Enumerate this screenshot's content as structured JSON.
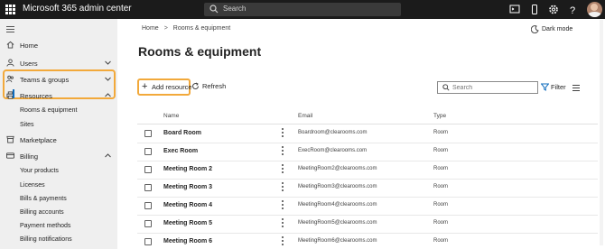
{
  "header": {
    "app_title": "Microsoft 365 admin center",
    "search_placeholder": "Search",
    "icons": [
      "waffle-icon",
      "search-icon",
      "terminal-icon",
      "mobile-icon",
      "settings-icon",
      "help-icon",
      "avatar"
    ]
  },
  "sidebar": {
    "items": [
      {
        "label": "Home",
        "icon": "home-icon"
      },
      {
        "label": "Users",
        "icon": "user-icon",
        "chevron": "down"
      },
      {
        "label": "Teams & groups",
        "icon": "people-icon",
        "chevron": "down"
      },
      {
        "label": "Resources",
        "icon": "printer-icon",
        "chevron": "up"
      },
      {
        "label": "Rooms & equipment",
        "sub": true,
        "selected": true
      },
      {
        "label": "Sites",
        "sub": true
      },
      {
        "label": "Marketplace",
        "icon": "store-icon"
      },
      {
        "label": "Billing",
        "icon": "credit-card-icon",
        "chevron": "up"
      },
      {
        "label": "Your products",
        "sub": true
      },
      {
        "label": "Licenses",
        "sub": true
      },
      {
        "label": "Bills & payments",
        "sub": true
      },
      {
        "label": "Billing accounts",
        "sub": true
      },
      {
        "label": "Payment methods",
        "sub": true
      },
      {
        "label": "Billing notifications",
        "sub": true
      }
    ]
  },
  "breadcrumb": {
    "home": "Home",
    "current": "Rooms & equipment"
  },
  "dark_mode_label": "Dark mode",
  "page_title": "Rooms & equipment",
  "toolbar": {
    "add_label": "Add resource",
    "refresh_label": "Refresh",
    "search_placeholder": "Search",
    "filter_label": "Filter"
  },
  "table": {
    "columns": [
      "Name",
      "Email",
      "Type"
    ],
    "rows": [
      {
        "name": "Board Room",
        "email": "Boardroom@clearooms.com",
        "type": "Room"
      },
      {
        "name": "Exec Room",
        "email": "ExecRoom@clearooms.com",
        "type": "Room"
      },
      {
        "name": "Meeting Room 2",
        "email": "MeetingRoom2@clearooms.com",
        "type": "Room"
      },
      {
        "name": "Meeting Room 3",
        "email": "MeetingRoom3@clearooms.com",
        "type": "Room"
      },
      {
        "name": "Meeting Room 4",
        "email": "MeetingRoom4@clearooms.com",
        "type": "Room"
      },
      {
        "name": "Meeting Room 5",
        "email": "MeetingRoom5@clearooms.com",
        "type": "Room"
      },
      {
        "name": "Meeting Room 6",
        "email": "MeetingRoom6@clearooms.com",
        "type": "Room"
      }
    ]
  },
  "colors": {
    "accent": "#0f6cbd",
    "highlight": "#f2a93b",
    "header_bg": "#1b1b1b",
    "sidebar_bg": "#efefef"
  }
}
